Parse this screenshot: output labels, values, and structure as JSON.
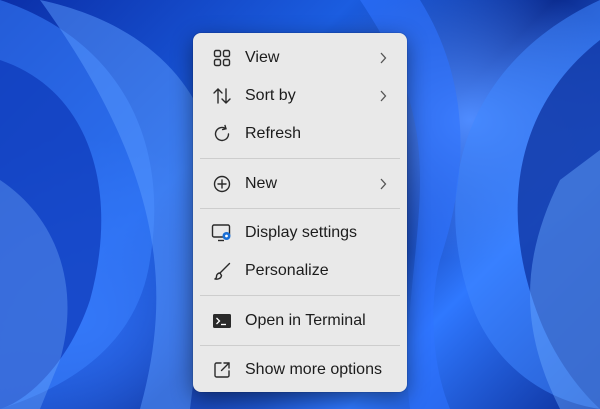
{
  "context_menu": {
    "items": [
      {
        "label": "View",
        "icon": "grid-icon",
        "has_submenu": true
      },
      {
        "label": "Sort by",
        "icon": "sort-arrows-icon",
        "has_submenu": true
      },
      {
        "label": "Refresh",
        "icon": "refresh-icon",
        "has_submenu": false
      },
      {
        "label": "New",
        "icon": "plus-circle-icon",
        "has_submenu": true
      },
      {
        "label": "Display settings",
        "icon": "display-settings-icon",
        "has_submenu": false,
        "highlighted": true
      },
      {
        "label": "Personalize",
        "icon": "brush-icon",
        "has_submenu": false
      },
      {
        "label": "Open in Terminal",
        "icon": "terminal-icon",
        "has_submenu": false
      },
      {
        "label": "Show more options",
        "icon": "expand-window-icon",
        "has_submenu": false
      }
    ]
  },
  "colors": {
    "highlight": "#ff4f6c",
    "menu_background": "#e9e9e9",
    "accent": "#1a6fd6"
  }
}
